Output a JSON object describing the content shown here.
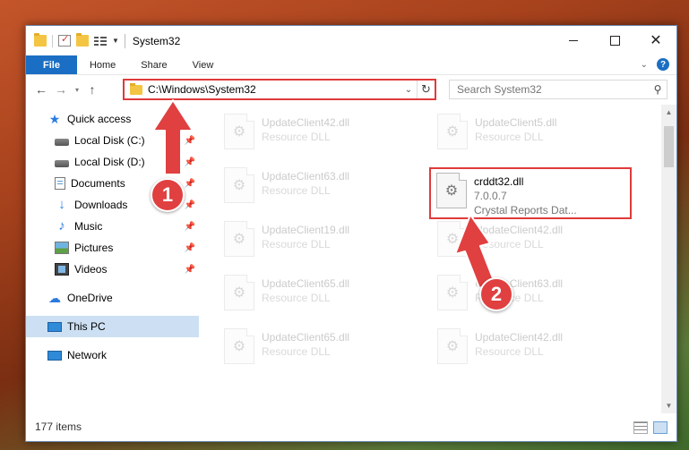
{
  "window": {
    "title": "System32",
    "controls": {
      "minimize": "",
      "maximize": "",
      "close": "✕"
    }
  },
  "ribbon": {
    "tabs": [
      "File",
      "Home",
      "Share",
      "View"
    ],
    "help": "?"
  },
  "address": {
    "path": "C:\\Windows\\System32",
    "search_placeholder": "Search System32"
  },
  "nav": {
    "quick_access": "Quick access",
    "items": [
      {
        "label": "Local Disk (C:)",
        "icon": "disk-icon",
        "pinned": true
      },
      {
        "label": "Local Disk (D:)",
        "icon": "disk-icon",
        "pinned": true
      },
      {
        "label": "Documents",
        "icon": "documents-icon",
        "pinned": true
      },
      {
        "label": "Downloads",
        "icon": "downloads-icon",
        "pinned": true
      },
      {
        "label": "Music",
        "icon": "music-icon",
        "pinned": true
      },
      {
        "label": "Pictures",
        "icon": "pictures-icon",
        "pinned": true
      },
      {
        "label": "Videos",
        "icon": "videos-icon",
        "pinned": true
      }
    ],
    "onedrive": "OneDrive",
    "this_pc": "This PC",
    "network": "Network"
  },
  "files": [
    {
      "name": "UpdateClient42.dll",
      "type": "Resource DLL"
    },
    {
      "name": "UpdateClient5.dll",
      "type": "Resource DLL"
    },
    {
      "name": "UpdateClient63.dll",
      "type": "Resource DLL"
    },
    {
      "name": "crddt32.dll",
      "version": "7.0.0.7",
      "description": "Crystal Reports Dat..."
    },
    {
      "name": "UpdateClient19.dll",
      "type": "Resource DLL"
    },
    {
      "name": "UpdateClient42.dll",
      "type": "Resource DLL"
    },
    {
      "name": "UpdateClient65.dll",
      "type": "Resource DLL"
    },
    {
      "name": "UpdateClient63.dll",
      "type": "Resource DLL"
    },
    {
      "name": "UpdateClient65.dll",
      "type": "Resource DLL"
    },
    {
      "name": "UpdateClient42.dll",
      "type": "Resource DLL"
    }
  ],
  "status": {
    "item_count": "177 items"
  },
  "callouts": [
    "1",
    "2"
  ],
  "colors": {
    "highlight": "#e03a3a",
    "accent": "#1a6fc4",
    "selection": "#cde0f3"
  }
}
